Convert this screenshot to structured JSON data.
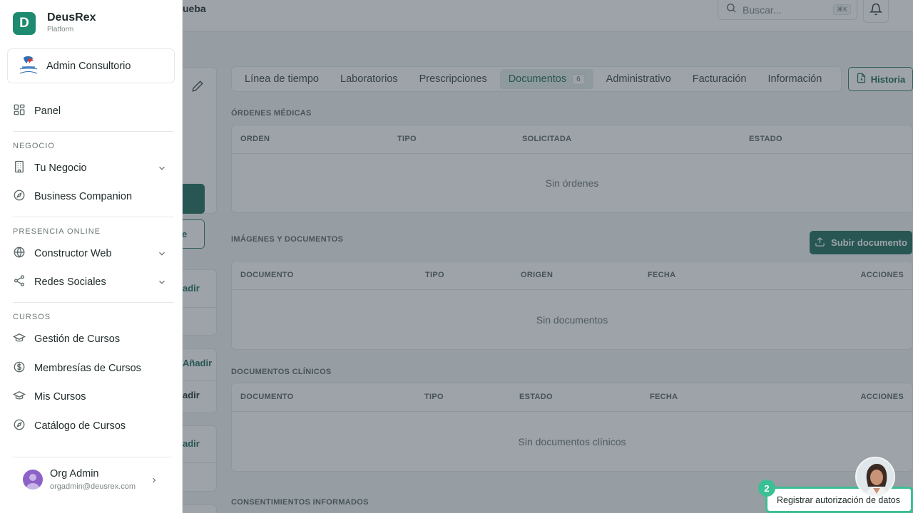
{
  "header": {
    "crumb": "ueba",
    "search_placeholder": "Buscar...",
    "search_shortcut": "⌘K"
  },
  "patient_panel": {
    "outline_button_label": "e",
    "add_label_1": "adir",
    "add_label_2": "Añadir",
    "add_label_3": "adir",
    "add_label_4": "adir"
  },
  "tabs": [
    {
      "label": "Línea de tiempo"
    },
    {
      "label": "Laboratorios"
    },
    {
      "label": "Prescripciones"
    },
    {
      "label": "Documentos",
      "badge": "6"
    },
    {
      "label": "Administrativo"
    },
    {
      "label": "Facturación"
    },
    {
      "label": "Información"
    }
  ],
  "history_button": "Historia",
  "sections": {
    "orders": {
      "title": "ÓRDENES MÉDICAS",
      "columns": [
        "ORDEN",
        "TIPO",
        "SOLICITADA",
        "ESTADO"
      ],
      "empty": "Sin órdenes"
    },
    "images": {
      "title": "IMÁGENES Y DOCUMENTOS",
      "upload_button": "Subir documento",
      "columns": [
        "DOCUMENTO",
        "TIPO",
        "ORIGEN",
        "FECHA",
        "ACCIONES"
      ],
      "empty": "Sin documentos"
    },
    "clinical": {
      "title": "DOCUMENTOS CLÍNICOS",
      "columns": [
        "DOCUMENTO",
        "TIPO",
        "ESTADO",
        "FECHA",
        "ACCIONES"
      ],
      "empty": "Sin documentos clínicos"
    },
    "consents": {
      "title": "CONSENTIMIENTOS INFORMADOS"
    }
  },
  "sidebar": {
    "brand_initial": "D",
    "brand_name": "DeusRex",
    "brand_sub": "Platform",
    "org_name": "Admin Consultorio",
    "panel_label": "Panel",
    "sections": [
      {
        "title": "NEGOCIO",
        "items": [
          {
            "label": "Tu Negocio",
            "icon": "building-icon",
            "expandable": true
          },
          {
            "label": "Business Companion",
            "icon": "compass-icon",
            "expandable": false
          }
        ]
      },
      {
        "title": "PRESENCIA ONLINE",
        "items": [
          {
            "label": "Constructor Web",
            "icon": "globe-icon",
            "expandable": true
          },
          {
            "label": "Redes Sociales",
            "icon": "share-icon",
            "expandable": true
          }
        ]
      },
      {
        "title": "CURSOS",
        "items": [
          {
            "label": "Gestión de Cursos",
            "icon": "graduation-cap-icon",
            "expandable": false
          },
          {
            "label": "Membresías de Cursos",
            "icon": "dollar-circle-icon",
            "expandable": false
          },
          {
            "label": "Mis Cursos",
            "icon": "graduation-cap-icon",
            "expandable": false
          },
          {
            "label": "Catálogo de Cursos",
            "icon": "compass-icon",
            "expandable": false
          }
        ]
      }
    ],
    "user": {
      "name": "Org Admin",
      "email": "orgadmin@deusrex.com"
    }
  },
  "floating": {
    "step_number": "2",
    "consent_button": "Registrar autorización de datos"
  },
  "colors": {
    "brand": "#1e8a6f",
    "primary": "#1e6b5c",
    "accent_highlight": "#3bbf94",
    "overlay": "#323e4a"
  }
}
